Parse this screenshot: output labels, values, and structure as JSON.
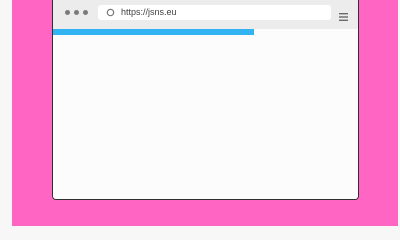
{
  "browser": {
    "url": "https://jsns.eu",
    "load_progress": 0.66
  },
  "icons": {
    "window_controls": "three-dots-icon",
    "url_security": "circle-icon",
    "menu": "hamburger-menu-icon"
  },
  "colors": {
    "background": "#ff66c4",
    "progress": "#33b3f2",
    "toolbar": "#ececec"
  }
}
